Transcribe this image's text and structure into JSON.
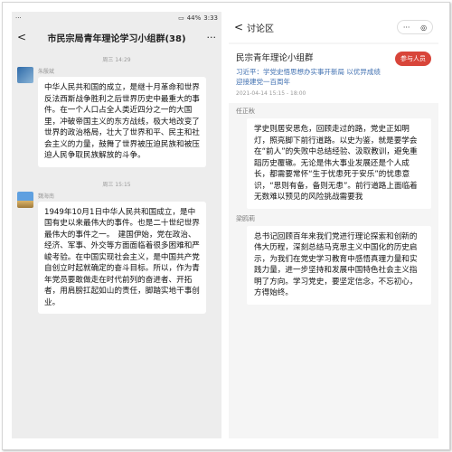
{
  "left": {
    "status_bar": {
      "left": "···",
      "right": "44%",
      "time": "3:33"
    },
    "header": {
      "back": "<",
      "title": "市民宗局青年理论学习小组群(38)",
      "more": "···"
    },
    "messages": [
      {
        "time": "周三 14:29",
        "sender": "朱殷斌",
        "text": "中华人民共和国的成立，是继十月革命和世界反法西斯战争胜利之后世界历史中最重大的事件。在一个人口占全人类近四分之一的大国里，冲破帝国主义的东方战线，极大地改变了世界的政治格局，壮大了世界和平、民主和社会主义的力量，鼓舞了世界被压迫民族和被压迫人民争取民族解放的斗争。"
      },
      {
        "time": "周三 15:15",
        "sender": "魏海南",
        "text": "1949年10月1日中华人民共和国成立，是中国有史以来最伟大的事件。也是二十世纪世界最伟大的事件之一。　建国伊始，党在政治、经济、军事、外交等方面面临着很多困难和严峻考验。在中国实现社会主义，是中国共产党自创立时起就确定的奋斗目标。所以，作为青年党员要敢做走在时代前列的奋进者、开拓者，用肩膀扛起如山的责任，脚踏实地干事创业。"
      }
    ]
  },
  "right": {
    "header": {
      "back": "<",
      "title": "讨论区",
      "capsule_more": "···",
      "capsule_close": "◎"
    },
    "group_card": {
      "name": "民宗青年理论小组群",
      "join_label": "参与人员",
      "topic": "习近平：学党史悟思想办实事开新局 以优异成绩迎接建党一百周年",
      "date": "2021-04-14 15:15 - 18:00"
    },
    "comments": [
      {
        "name": "任正秋",
        "text": "学史则居安思危，回顾走过的路，党史正如明灯，照亮脚下前行道路。以史为鉴，就是要学会在“前人”的失败中总结经验、汲取教训，避免重蹈历史覆辙。无论是伟大事业发展还是个人成长，都需要常怀“生于忧患死于安乐”的忧患意识，“思则有备，备则无患”。前行道路上面临着无数难以预见的风险挑战需要我"
      },
      {
        "name": "梁鸥莉",
        "text": "总书记回顾百年来我们党进行理论探索和创新的伟大历程，深刻总结马克思主义中国化的历史启示，为我们在党史学习教育中感悟真理力量和实践力量，进一步坚持和发展中国特色社会主义指明了方向。学习党史，要坚定信念，不忘初心，方得始终。"
      }
    ]
  }
}
